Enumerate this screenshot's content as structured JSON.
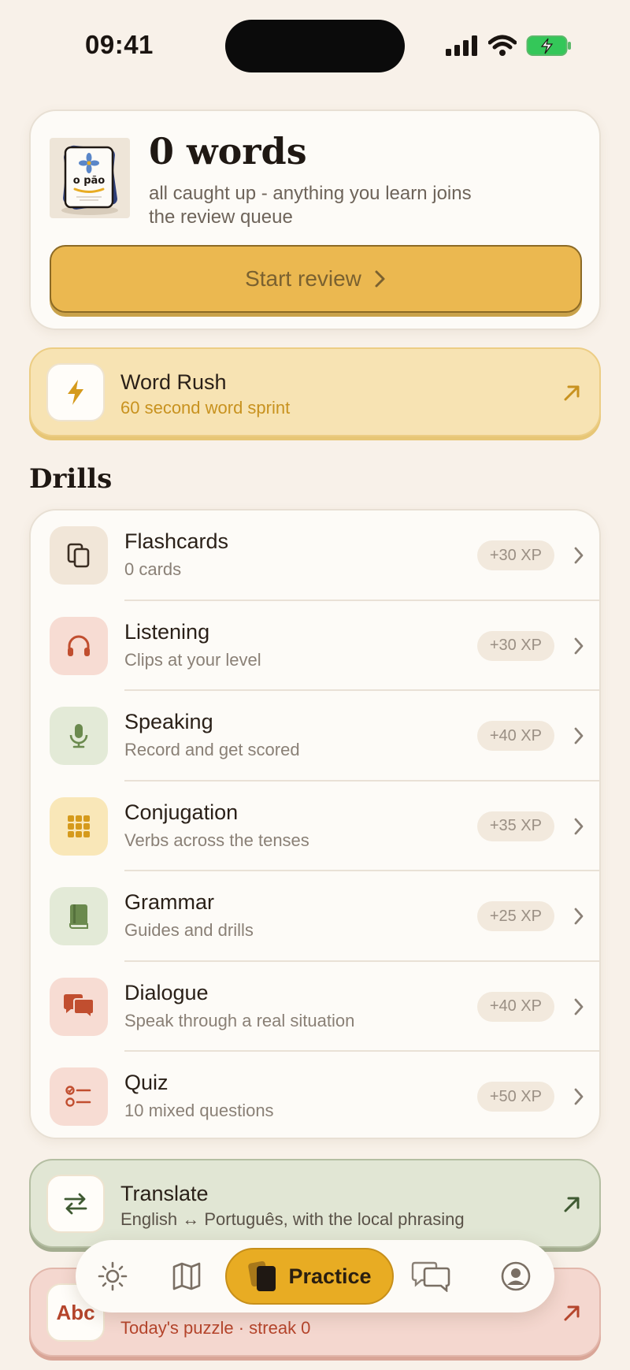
{
  "status": {
    "time": "09:41"
  },
  "hero": {
    "title": "0 words",
    "subtitle": "all caught up - anything you learn joins the review queue",
    "card_word": "o pão",
    "start_label": "Start review"
  },
  "word_rush": {
    "title": "Word Rush",
    "subtitle": "60 second word sprint"
  },
  "drills_heading": "Drills",
  "drills": [
    {
      "title": "Flashcards",
      "subtitle": "0 cards",
      "xp": "+30 XP",
      "icon": "flashcards-icon"
    },
    {
      "title": "Listening",
      "subtitle": "Clips at your level",
      "xp": "+30 XP",
      "icon": "headphones-icon"
    },
    {
      "title": "Speaking",
      "subtitle": "Record and get scored",
      "xp": "+40 XP",
      "icon": "microphone-icon"
    },
    {
      "title": "Conjugation",
      "subtitle": "Verbs across the tenses",
      "xp": "+35 XP",
      "icon": "grid-icon"
    },
    {
      "title": "Grammar",
      "subtitle": "Guides and drills",
      "xp": "+25 XP",
      "icon": "book-icon"
    },
    {
      "title": "Dialogue",
      "subtitle": "Speak through a real situation",
      "xp": "+40 XP",
      "icon": "chat-bubbles-icon"
    },
    {
      "title": "Quiz",
      "subtitle": "10 mixed questions",
      "xp": "+50 XP",
      "icon": "checklist-icon"
    }
  ],
  "translate": {
    "title": "Translate",
    "subtitle": "English ↔ Português, with the local phrasing"
  },
  "puzzle": {
    "icon_text": "Abc",
    "subtitle": "Today's puzzle · streak 0"
  },
  "nav": {
    "practice_label": "Practice"
  },
  "colors": {
    "accent": "#e8ac23",
    "background": "#f8f1e9",
    "card": "#fdfbf7"
  }
}
